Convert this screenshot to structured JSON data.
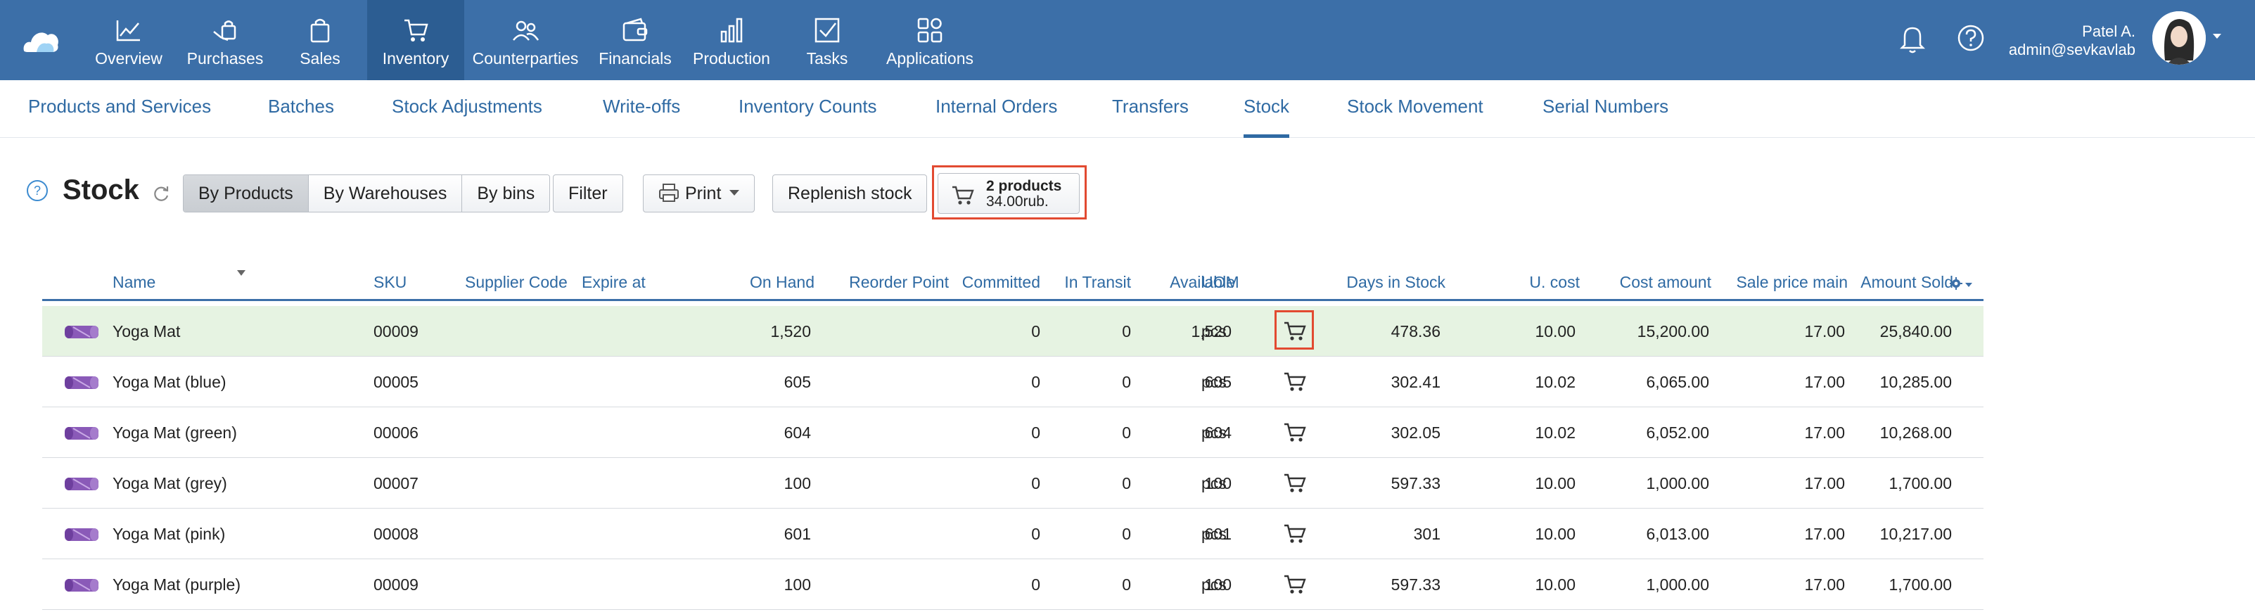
{
  "topnav": {
    "items": [
      {
        "label": "Overview"
      },
      {
        "label": "Purchases"
      },
      {
        "label": "Sales"
      },
      {
        "label": "Inventory"
      },
      {
        "label": "Counterparties"
      },
      {
        "label": "Financials"
      },
      {
        "label": "Production"
      },
      {
        "label": "Tasks"
      },
      {
        "label": "Applications"
      }
    ],
    "active": "Inventory",
    "user_name": "Patel A.",
    "user_email": "admin@sevkavlab"
  },
  "subnav": {
    "tabs": [
      {
        "label": "Products and Services"
      },
      {
        "label": "Batches"
      },
      {
        "label": "Stock Adjustments"
      },
      {
        "label": "Write-offs"
      },
      {
        "label": "Inventory Counts"
      },
      {
        "label": "Internal Orders"
      },
      {
        "label": "Transfers"
      },
      {
        "label": "Stock"
      },
      {
        "label": "Stock Movement"
      },
      {
        "label": "Serial Numbers"
      }
    ],
    "active": "Stock"
  },
  "toolbar": {
    "help": "?",
    "title": "Stock",
    "view_modes": [
      "By Products",
      "By Warehouses",
      "By bins"
    ],
    "active_view": "By Products",
    "filter": "Filter",
    "print": "Print",
    "replenish": "Replenish stock",
    "cart_count": "2 products",
    "cart_total": "34.00rub."
  },
  "table": {
    "columns": {
      "name": "Name",
      "sku": "SKU",
      "supplier_code": "Supplier Code",
      "expire_at": "Expire at",
      "on_hand": "On Hand",
      "reorder_point": "Reorder Point",
      "committed": "Committed",
      "in_transit": "In Transit",
      "available": "Available",
      "uom": "UOM",
      "days_in_stock": "Days in Stock",
      "u_cost": "U. cost",
      "cost_amount": "Cost amount",
      "sale_price": "Sale price main",
      "amount_sold": "Amount Sold"
    },
    "rows": [
      {
        "name": "Yoga Mat",
        "sku": "00009",
        "supplier_code": "",
        "expire_at": "",
        "on_hand": "1,520",
        "reorder_point": "",
        "committed": "0",
        "in_transit": "0",
        "available": "1,520",
        "uom": "pcs",
        "days": "478.36",
        "u_cost": "10.00",
        "cost_amount": "15,200.00",
        "sale_price": "17.00",
        "amount_sold": "25,840.00"
      },
      {
        "name": "Yoga Mat (blue)",
        "sku": "00005",
        "supplier_code": "",
        "expire_at": "",
        "on_hand": "605",
        "reorder_point": "",
        "committed": "0",
        "in_transit": "0",
        "available": "605",
        "uom": "pcs",
        "days": "302.41",
        "u_cost": "10.02",
        "cost_amount": "6,065.00",
        "sale_price": "17.00",
        "amount_sold": "10,285.00"
      },
      {
        "name": "Yoga Mat (green)",
        "sku": "00006",
        "supplier_code": "",
        "expire_at": "",
        "on_hand": "604",
        "reorder_point": "",
        "committed": "0",
        "in_transit": "0",
        "available": "604",
        "uom": "pcs",
        "days": "302.05",
        "u_cost": "10.02",
        "cost_amount": "6,052.00",
        "sale_price": "17.00",
        "amount_sold": "10,268.00"
      },
      {
        "name": "Yoga Mat (grey)",
        "sku": "00007",
        "supplier_code": "",
        "expire_at": "",
        "on_hand": "100",
        "reorder_point": "",
        "committed": "0",
        "in_transit": "0",
        "available": "100",
        "uom": "pcs",
        "days": "597.33",
        "u_cost": "10.00",
        "cost_amount": "1,000.00",
        "sale_price": "17.00",
        "amount_sold": "1,700.00"
      },
      {
        "name": "Yoga Mat (pink)",
        "sku": "00008",
        "supplier_code": "",
        "expire_at": "",
        "on_hand": "601",
        "reorder_point": "",
        "committed": "0",
        "in_transit": "0",
        "available": "601",
        "uom": "pcs",
        "days": "301",
        "u_cost": "10.00",
        "cost_amount": "6,013.00",
        "sale_price": "17.00",
        "amount_sold": "10,217.00"
      },
      {
        "name": "Yoga Mat (purple)",
        "sku": "00009",
        "supplier_code": "",
        "expire_at": "",
        "on_hand": "100",
        "reorder_point": "",
        "committed": "0",
        "in_transit": "0",
        "available": "100",
        "uom": "pcs",
        "days": "597.33",
        "u_cost": "10.00",
        "cost_amount": "1,000.00",
        "sale_price": "17.00",
        "amount_sold": "1,700.00"
      }
    ]
  },
  "icons": {
    "logo": "cloud-logo-icon",
    "nav": [
      "chart-line-icon",
      "hand-bag-icon",
      "shopping-bag-icon",
      "cart-icon",
      "people-icon",
      "wallet-icon",
      "bar-chart-icon",
      "checkbox-icon",
      "apps-grid-icon"
    ],
    "bell": "bell-icon",
    "help": "question-icon",
    "refresh": "refresh-icon",
    "print": "printer-icon",
    "row_cart": "cart-icon",
    "product_thumb": "yoga-mat-icon",
    "settings": "gear-icon"
  },
  "colors": {
    "topbar": "#3c6fa8",
    "topbar_active": "#2c5d92",
    "link": "#2f6aa3",
    "highlight_row": "#e6f3e2",
    "annotation": "#e24a31",
    "thumb_purple": "#8a5ab8"
  }
}
